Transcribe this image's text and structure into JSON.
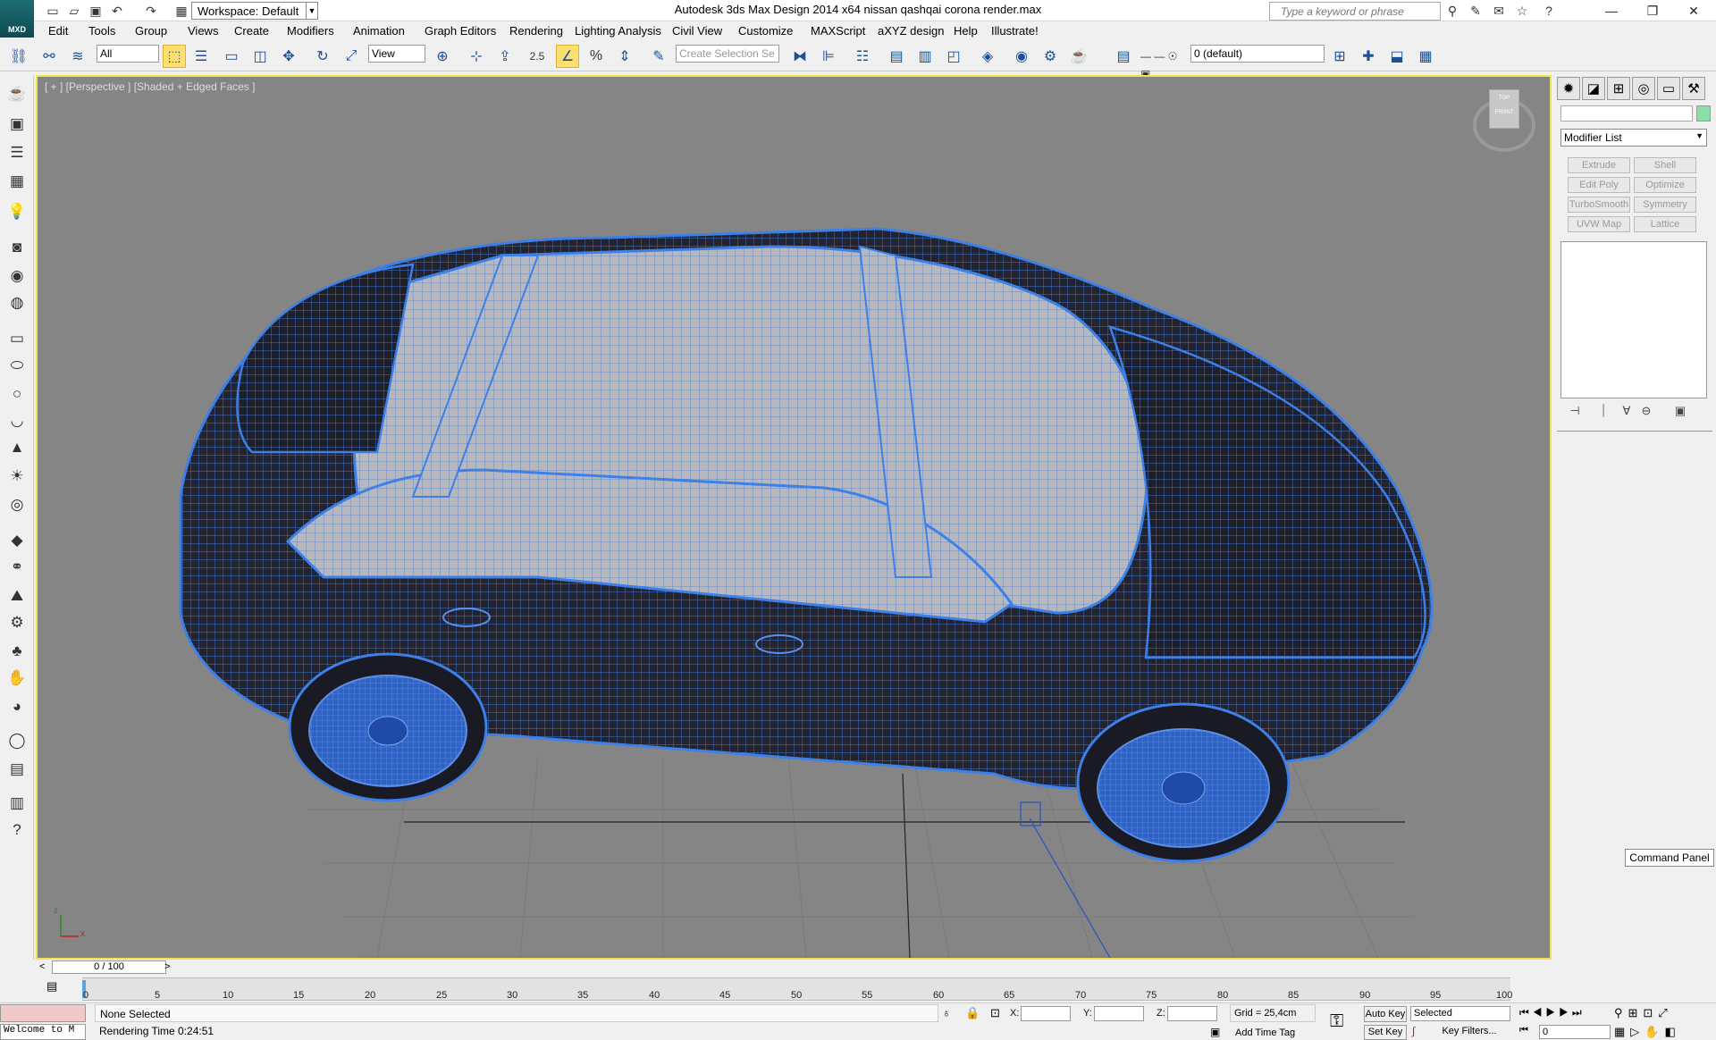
{
  "titlebar": {
    "logo_text": "MXD",
    "app_title": "Autodesk 3ds Max Design 2014 x64     nissan qashqai corona render.max",
    "workspace": "Workspace: Default",
    "search_placeholder": "Type a keyword or phrase"
  },
  "menus": [
    "Edit",
    "Tools",
    "Group",
    "Views",
    "Create",
    "Modifiers",
    "Animation",
    "Graph Editors",
    "Rendering",
    "Lighting Analysis",
    "Civil View",
    "Customize",
    "MAXScript",
    "aXYZ design",
    "Help",
    "Illustrate!"
  ],
  "toolbar": {
    "selection_filter": "All",
    "ref_coord": "View",
    "snap_value": "2.5",
    "named_selection": "Create Selection Se",
    "layer": "0 (default)"
  },
  "viewport": {
    "label": "[ + ] [Perspective ] [Shaded + Edged Faces ]",
    "viewcube_top": "TOP",
    "viewcube_front": "FRONT",
    "axis_x": "x",
    "axis_z": "z"
  },
  "command_panel": {
    "modifier_list": "Modifier List",
    "buttons": [
      "Extrude",
      "Shell",
      "Edit Poly",
      "Optimize",
      "TurboSmooth",
      "Symmetry",
      "UVW Map",
      "Lattice"
    ],
    "tooltip": "Command Panel"
  },
  "timeline": {
    "slider": "0 / 100",
    "ticks": [
      "0",
      "5",
      "10",
      "15",
      "20",
      "25",
      "30",
      "35",
      "40",
      "45",
      "50",
      "55",
      "60",
      "65",
      "70",
      "75",
      "80",
      "85",
      "90",
      "95",
      "100"
    ]
  },
  "status": {
    "welcome": "Welcome to M",
    "selection": "None Selected",
    "render_time": "Rendering Time  0:24:51",
    "x_label": "X:",
    "y_label": "Y:",
    "z_label": "Z:",
    "grid": "Grid = 25,4cm",
    "add_time_tag": "Add Time Tag",
    "auto_key": "Auto Key",
    "set_key": "Set Key",
    "key_mode": "Selected",
    "key_filters": "Key Filters...",
    "frame": "0"
  }
}
